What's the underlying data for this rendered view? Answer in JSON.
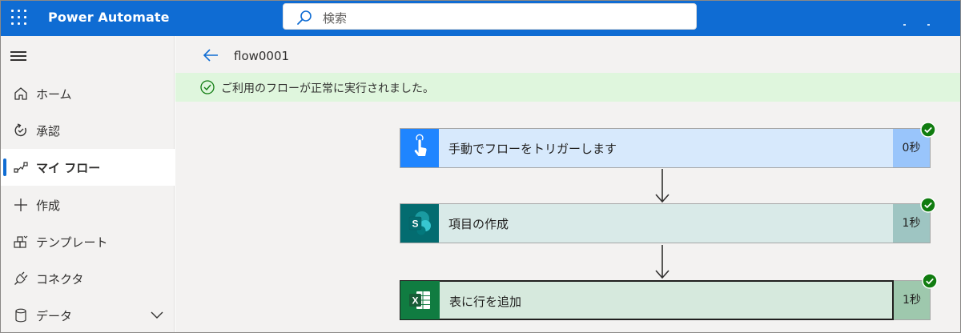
{
  "header": {
    "app_title": "Power Automate",
    "search_placeholder": "検索"
  },
  "sidebar": {
    "items": [
      {
        "label": "ホーム",
        "icon": "home-icon"
      },
      {
        "label": "承認",
        "icon": "approvals-icon"
      },
      {
        "label": "マイ フロー",
        "icon": "my-flows-icon",
        "active": true
      },
      {
        "label": "作成",
        "icon": "plus-icon"
      },
      {
        "label": "テンプレート",
        "icon": "templates-icon"
      },
      {
        "label": "コネクタ",
        "icon": "connector-icon"
      },
      {
        "label": "データ",
        "icon": "database-icon"
      }
    ]
  },
  "main": {
    "flow_name": "flow0001",
    "banner_text": "ご利用のフローが正常に実行されました。",
    "steps": [
      {
        "title": "手動でフローをトリガーします",
        "duration": "0秒",
        "icon": "manual-trigger-icon"
      },
      {
        "title": "項目の作成",
        "duration": "1秒",
        "icon": "sharepoint-icon"
      },
      {
        "title": "表に行を追加",
        "duration": "1秒",
        "icon": "excel-icon"
      }
    ]
  },
  "colors": {
    "brand": "#0f6cd3",
    "success": "#107c10",
    "banner": "#dff6dd",
    "trigger_bg": "#d7e9fc",
    "trigger_tile": "#1f85ff",
    "sharepoint_bg": "#d9eae8",
    "sharepoint_tile": "#036c70",
    "excel_bg": "#d6e9dd",
    "excel_tile": "#107c41"
  }
}
